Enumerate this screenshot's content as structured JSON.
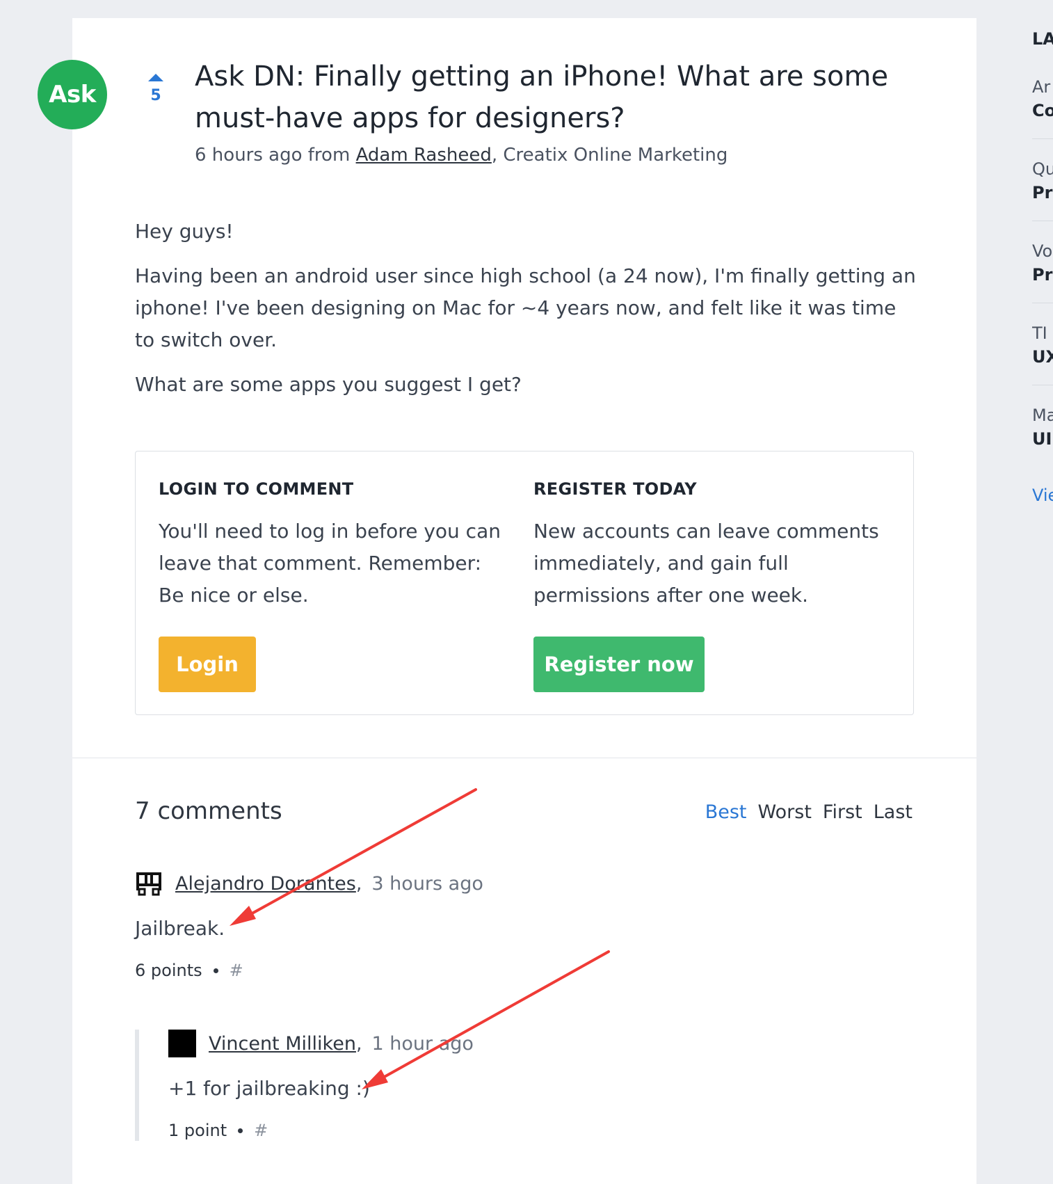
{
  "post": {
    "badge": "Ask",
    "votes": "5",
    "title": "Ask DN: Finally getting an iPhone! What are some must-have apps for designers?",
    "meta_prefix": "6 hours ago from ",
    "author": "Adam Rasheed",
    "meta_suffix": ", Creatix Online Marketing",
    "body": [
      "Hey guys!",
      "Having been an android user since high school (a 24 now), I'm finally getting an iphone! I've been designing on Mac for ~4 years now, and felt like it was time to switch over.",
      "What are some apps you suggest I get?"
    ]
  },
  "login_box": {
    "login_heading": "LOGIN TO COMMENT",
    "login_text": "You'll need to log in before you can leave that comment. Remember: Be nice or else.",
    "login_button": "Login",
    "register_heading": "REGISTER TODAY",
    "register_text": "New accounts can leave comments immediately, and gain full permissions after one week.",
    "register_button": "Register now"
  },
  "comments": {
    "title": "7 comments",
    "sort_options": [
      "Best",
      "Worst",
      "First",
      "Last"
    ],
    "active_sort": "Best",
    "items": [
      {
        "author": "Alejandro Dorantes",
        "time": "3 hours ago",
        "text": "Jailbreak.",
        "points": "6 points",
        "hash": "#",
        "avatar_icon": "pixel-glyph-avatar"
      },
      {
        "author": "Vincent Milliken",
        "time": "1 hour ago",
        "text": "+1 for jailbreaking :)",
        "points": "1 point",
        "hash": "#",
        "avatar_icon": "black-square-avatar"
      }
    ]
  },
  "sidebar": {
    "heading": "LA",
    "items": [
      {
        "top": "Ar",
        "bottom": "Co"
      },
      {
        "top": "Qu",
        "bottom": "Pr"
      },
      {
        "top": "Vo",
        "bottom": "Pri"
      },
      {
        "top": "TI",
        "bottom": "UX"
      },
      {
        "top": "Ma",
        "bottom": "UI"
      }
    ],
    "view_link": "Vie"
  },
  "colors": {
    "accent_blue": "#2a77d4",
    "ask_green": "#23ad58",
    "login_yellow": "#f3b22e",
    "register_green": "#3fb96e",
    "annotation_red": "#ef3b36"
  }
}
